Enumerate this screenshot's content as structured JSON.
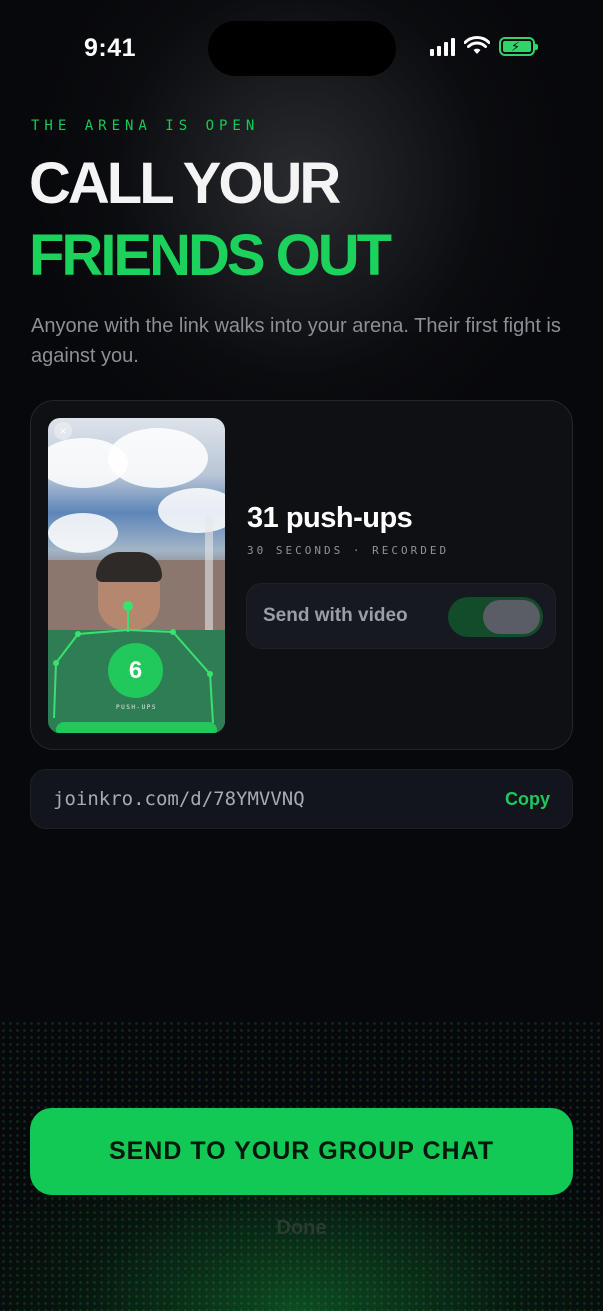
{
  "status_bar": {
    "time": "9:41"
  },
  "header": {
    "eyebrow": "THE ARENA IS OPEN",
    "title_line1": "CALL YOUR",
    "title_line2": "FRIENDS OUT",
    "subtitle": "Anyone with the link walks into your arena. Their first fight is against you."
  },
  "recording_card": {
    "rep_count": "6",
    "rep_label": "PUSH-UPS",
    "close_glyph": "×",
    "title": "31 push-ups",
    "meta": "30 SECONDS · RECORDED",
    "toggle_label": "Send with video",
    "toggle_on": true
  },
  "share_link": {
    "url": "joinkro.com/d/78YMVVNQ",
    "copy_label": "Copy"
  },
  "actions": {
    "primary": "SEND TO YOUR GROUP CHAT",
    "secondary": "Done"
  },
  "colors": {
    "accent": "#1cd15c",
    "background": "#07080b",
    "card": "#0e1014"
  },
  "icons": [
    "cellular-signal-icon",
    "wifi-icon",
    "battery-charging-icon",
    "close-icon"
  ]
}
